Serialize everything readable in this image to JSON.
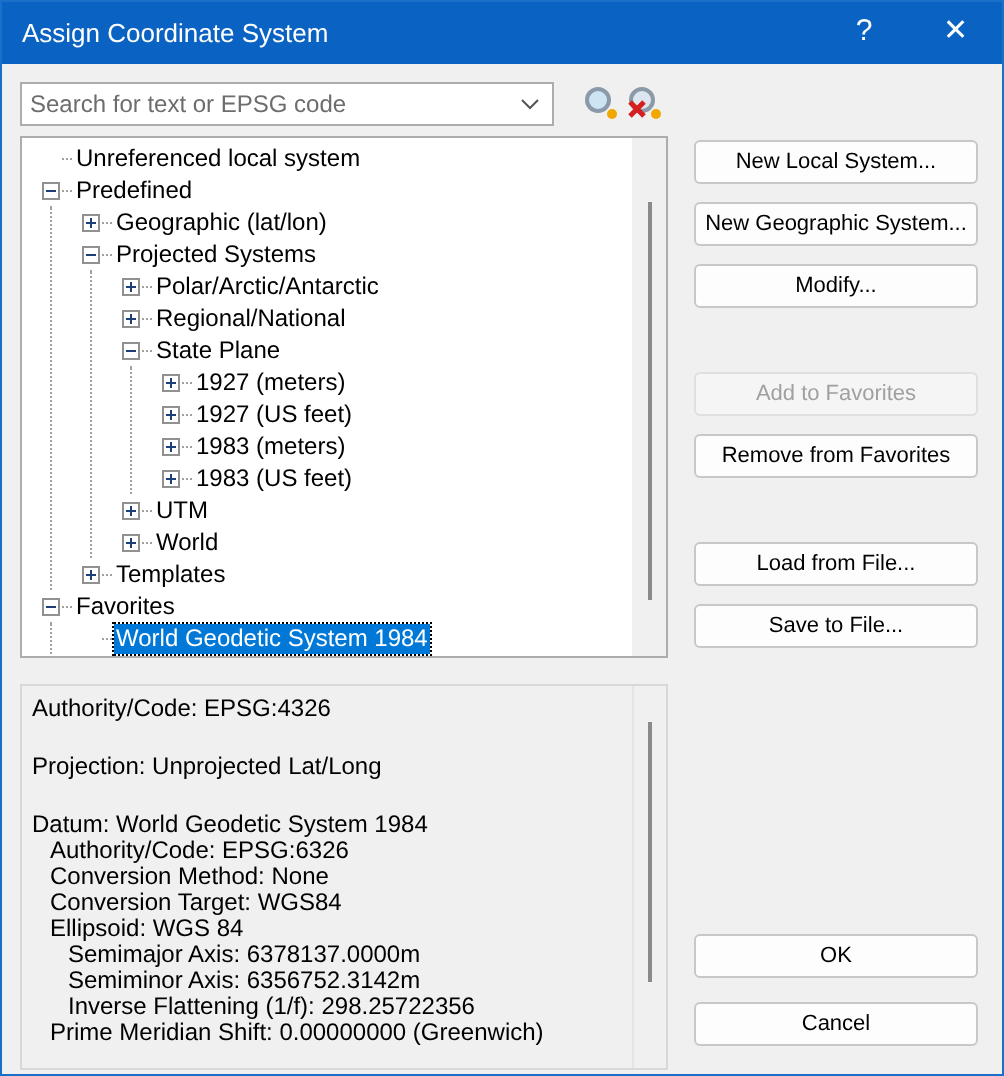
{
  "window": {
    "title": "Assign Coordinate System",
    "help": "?",
    "close": "✕"
  },
  "search": {
    "placeholder": "Search for text or EPSG code"
  },
  "tree": [
    {
      "label": "Unreferenced local system",
      "selected": false
    },
    {
      "label": "Predefined",
      "selected": false,
      "expanded": true,
      "children": [
        {
          "label": "Geographic (lat/lon)",
          "selected": false,
          "expanded": false
        },
        {
          "label": "Projected Systems",
          "selected": false,
          "expanded": true,
          "children": [
            {
              "label": "Polar/Arctic/Antarctic",
              "selected": false,
              "expanded": false
            },
            {
              "label": "Regional/National",
              "selected": false,
              "expanded": false
            },
            {
              "label": "State Plane",
              "selected": false,
              "expanded": true,
              "children": [
                {
                  "label": "1927 (meters)",
                  "selected": false,
                  "expanded": false
                },
                {
                  "label": "1927 (US feet)",
                  "selected": false,
                  "expanded": false
                },
                {
                  "label": "1983 (meters)",
                  "selected": false,
                  "expanded": false
                },
                {
                  "label": "1983 (US feet)",
                  "selected": false,
                  "expanded": false
                }
              ]
            },
            {
              "label": "UTM",
              "selected": false,
              "expanded": false
            },
            {
              "label": "World",
              "selected": false,
              "expanded": false
            }
          ]
        },
        {
          "label": "Templates",
          "selected": false,
          "expanded": false
        }
      ]
    },
    {
      "label": "Favorites",
      "selected": false,
      "expanded": true,
      "children": [
        {
          "label": "World Geodetic System 1984",
          "selected": true
        }
      ]
    }
  ],
  "details": [
    {
      "text": "Authority/Code: EPSG:4326"
    },
    {
      "text": "Projection: Unprojected Lat/Long"
    },
    {
      "text": "Datum: World Geodetic System 1984",
      "children": [
        {
          "text": "Authority/Code: EPSG:6326"
        },
        {
          "text": "Conversion Method: None"
        },
        {
          "text": "Conversion Target: WGS84"
        },
        {
          "text": "Ellipsoid: WGS 84",
          "children": [
            {
              "text": "Semimajor Axis: 6378137.0000m"
            },
            {
              "text": "Semiminor Axis: 6356752.3142m"
            },
            {
              "text": "Inverse Flattening (1/f): 298.25722356"
            }
          ]
        },
        {
          "text": "Prime Meridian Shift: 0.00000000 (Greenwich)"
        }
      ]
    }
  ],
  "side_button_groups": [
    [
      {
        "label": "New Local System...",
        "disabled": false
      },
      {
        "label": "New Geographic System...",
        "disabled": false
      },
      {
        "label": "Modify...",
        "disabled": false
      }
    ],
    [
      {
        "label": "Add to Favorites",
        "disabled": true
      },
      {
        "label": "Remove from Favorites",
        "disabled": false
      }
    ],
    [
      {
        "label": "Load from File...",
        "disabled": false
      },
      {
        "label": "Save to File...",
        "disabled": false
      }
    ]
  ],
  "dialog_buttons": [
    "OK",
    "Cancel"
  ]
}
